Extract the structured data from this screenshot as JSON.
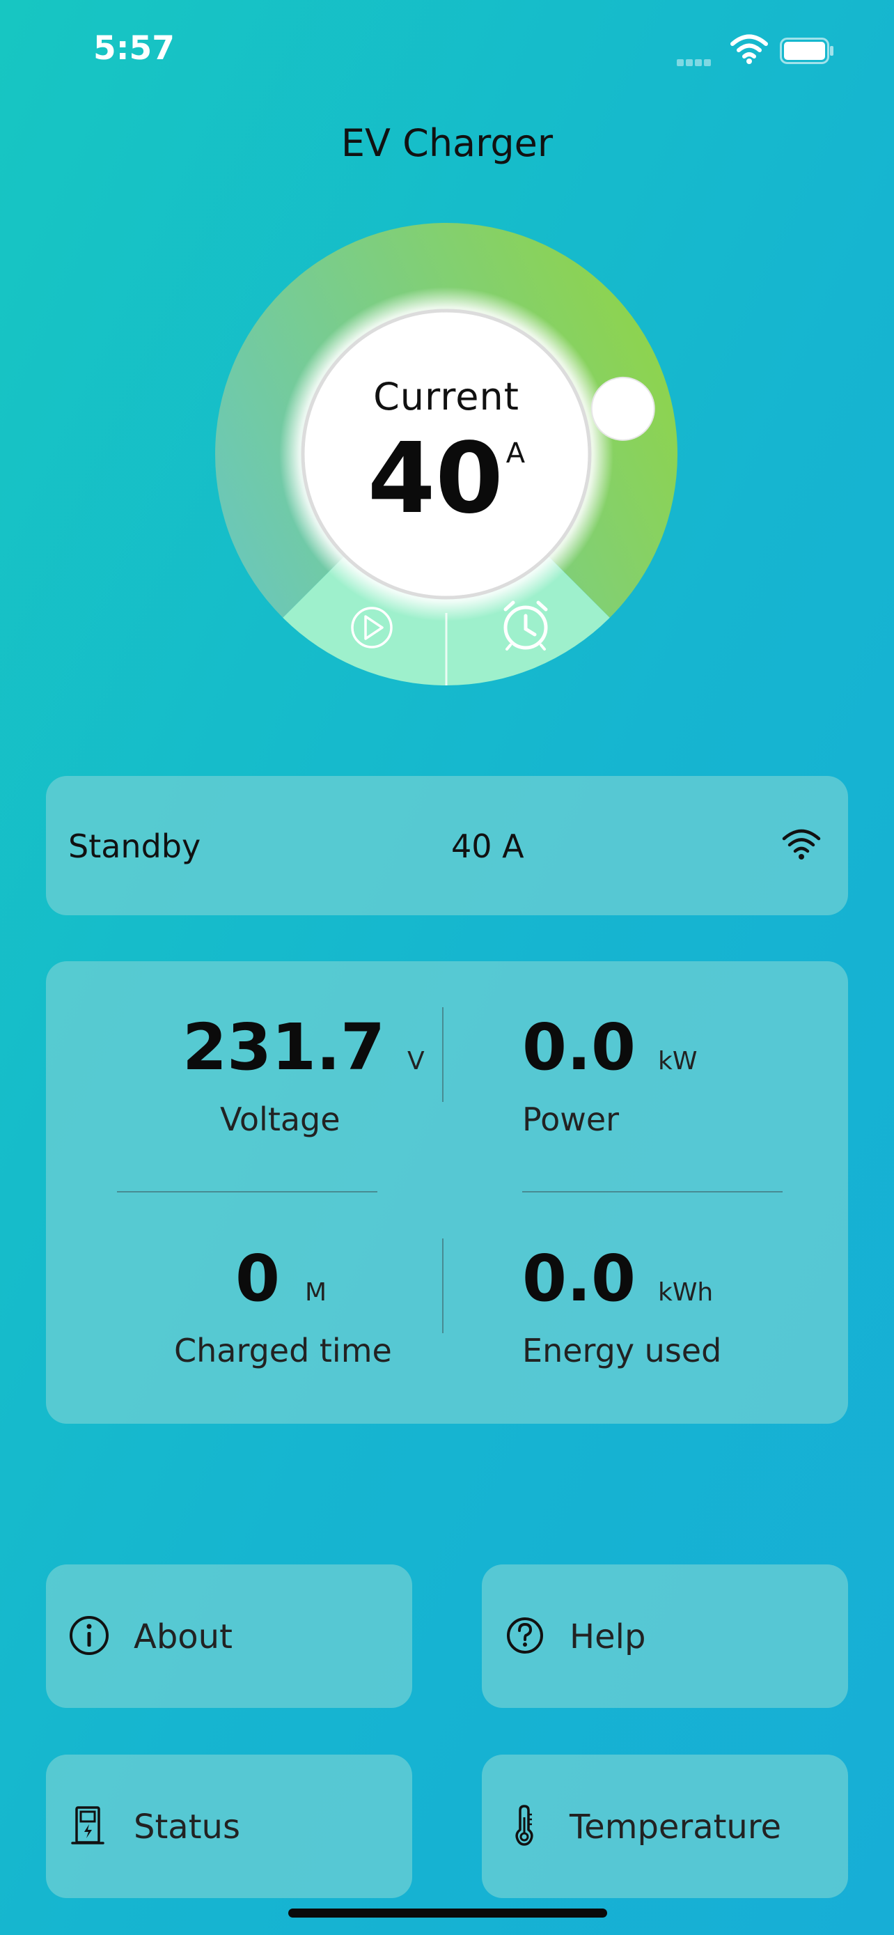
{
  "status_bar": {
    "time": "5:57"
  },
  "app": {
    "title": "EV Charger"
  },
  "gauge": {
    "label": "Current",
    "value": "40",
    "unit": "A",
    "slider_fraction": 0.78
  },
  "state": {
    "status": "Standby",
    "current": "40 A"
  },
  "metrics": {
    "voltage": {
      "value": "231.7",
      "unit": "V",
      "label": "Voltage"
    },
    "power": {
      "value": "0.0",
      "unit": "kW",
      "label": "Power"
    },
    "charged_time": {
      "value": "0",
      "unit": "M",
      "label": "Charged time"
    },
    "energy_used": {
      "value": "0.0",
      "unit": "kWh",
      "label": "Energy used"
    }
  },
  "buttons": {
    "about": {
      "label": "About",
      "icon": "info-icon"
    },
    "help": {
      "label": "Help",
      "icon": "help-icon"
    },
    "status": {
      "label": "Status",
      "icon": "charger-station-icon"
    },
    "temperature": {
      "label": "Temperature",
      "icon": "thermometer-icon"
    }
  },
  "colors": {
    "background_start": "#17c6c2",
    "background_end": "#17aed6",
    "card": "#6fd0d4",
    "gauge_start": "#6cc8b6",
    "gauge_end": "#8fd44a",
    "gauge_base": "#9ef0cc"
  }
}
